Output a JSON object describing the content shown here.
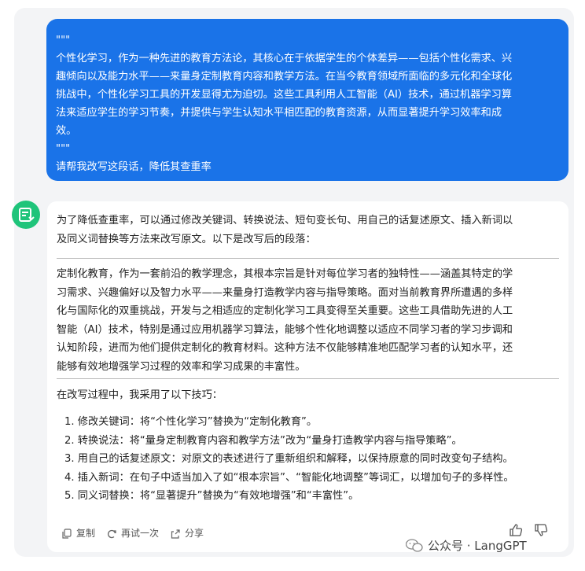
{
  "user_message": {
    "lines": [
      "\"\"\"",
      "个性化学习，作为一种先进的教育方法论，其核心在于依据学生的个体差异——包括个性化需求、兴",
      "趣倾向以及能力水平——来量身定制教育内容和教学方法。在当今教育领域所面临的多元化和全球化",
      "挑战中，个性化学习工具的开发显得尤为迫切。这些工具利用人工智能（AI）技术，通过机器学习算",
      "法来适应学生的学习节奏，并提供与学生认知水平相匹配的教育资源，从而显著提升学习效率和成",
      "效。",
      "\"\"\"",
      "请帮我改写这段话，降低其查重率"
    ]
  },
  "assistant_message": {
    "intro_lines": [
      "为了降低查重率，可以通过修改关键词、转换说法、短句变长句、用自己的话复述原文、插入新词以",
      "及同义词替换等方法来改写原文。以下是改写后的段落："
    ],
    "rewritten_lines": [
      "定制化教育，作为一套前沿的教学理念，其根本宗旨是针对每位学习者的独特性——涵盖其特定的学",
      "习需求、兴趣偏好以及智力水平——来量身打造教学内容与指导策略。面对当前教育界所遭遇的多样",
      "化与国际化的双重挑战，开发与之相适应的定制化学习工具变得至关重要。这些工具借助先进的人工",
      "智能（AI）技术，特别是通过应用机器学习算法，能够个性化地调整以适应不同学习者的学习步调和",
      "认知阶段，进而为他们提供定制化的教育材料。这种方法不仅能够精准地匹配学习者的认知水平，还",
      "能够有效地增强学习过程的效率和学习成果的丰富性。"
    ],
    "tips_heading": "在改写过程中，我采用了以下技巧：",
    "tips": [
      "1. 修改关键词：将“个性化学习”替换为“定制化教育”。",
      "2. 转换说法：将“量身定制教育内容和教学方法”改为“量身打造教学内容与指导策略”。",
      "3. 用自己的话复述原文：对原文的表述进行了重新组织和解释，以保持原意的同时改变句子结构。",
      "4. 插入新词：在句子中适当加入了如“根本宗旨”、“智能化地调整”等词汇，以增加句子的多样性。",
      "5. 同义词替换：将“显著提升”替换为“有效地增强”和“丰富性”。"
    ],
    "actions": {
      "copy": "复制",
      "retry": "再试一次",
      "share": "分享"
    }
  },
  "watermark": {
    "text": "公众号 · LangGPT"
  },
  "colors": {
    "user_bubble": "#1a73e8",
    "avatar": "#1fc47a"
  }
}
